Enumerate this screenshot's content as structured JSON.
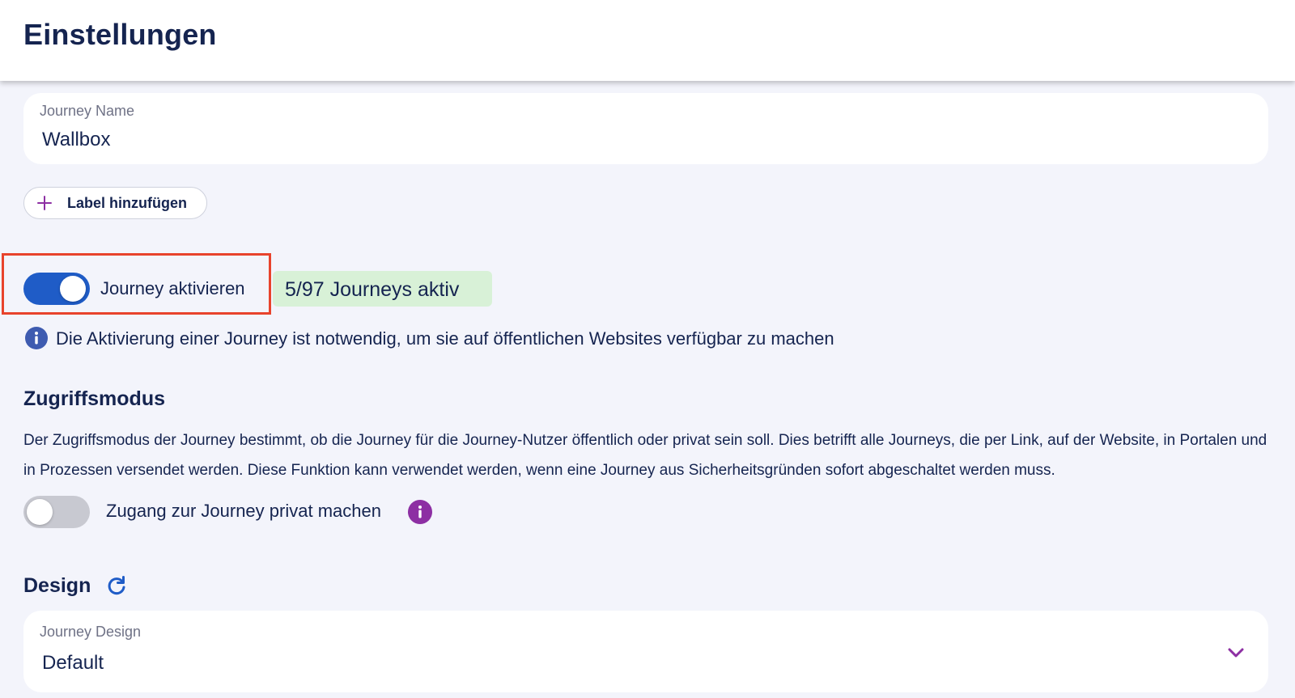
{
  "header": {
    "title": "Einstellungen"
  },
  "journey_name": {
    "label": "Journey Name",
    "value": "Wallbox"
  },
  "label_button": {
    "label": "Label hinzufügen",
    "icon": "plus-icon"
  },
  "activation": {
    "toggle_label": "Journey aktivieren",
    "enabled": true,
    "badge": "5/97 Journeys aktiv",
    "info_text": "Die Aktivierung einer Journey ist notwendig, um sie auf öffentlichen Websites verfügbar zu machen",
    "info_icon": "info-icon"
  },
  "access_mode": {
    "heading": "Zugriffsmodus",
    "description": "Der Zugriffsmodus der Journey bestimmt, ob die Journey für die Journey-Nutzer öffentlich oder privat sein soll. Dies betrifft alle Journeys, die per Link, auf der Website, in Portalen und in Prozessen versendet werden. Diese Funktion kann verwendet werden, wenn eine Journey aus Sicherheitsgründen sofort abgeschaltet werden muss.",
    "toggle_label": "Zugang zur Journey privat machen",
    "enabled": false,
    "info_icon": "info-icon"
  },
  "design": {
    "heading": "Design",
    "refresh_icon": "refresh-icon",
    "field_label": "Journey Design",
    "value": "Default",
    "dropdown_icon": "chevron-down-icon"
  },
  "colors": {
    "text": "#152450",
    "background": "#f3f4fb",
    "toggle_on": "#1f5cc7",
    "toggle_off": "#c8c9d1",
    "badge_bg": "#d8f1d7",
    "accent_purple": "#8d2fa3",
    "info_blue": "#3e5bb0",
    "highlight": "#e8432c"
  }
}
